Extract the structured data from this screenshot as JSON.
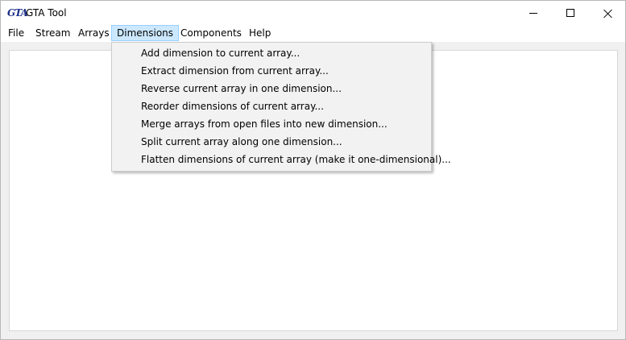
{
  "window": {
    "app_icon_text": "GTA",
    "title": "GTA Tool"
  },
  "menubar": {
    "items": [
      {
        "label": "File"
      },
      {
        "label": "Stream"
      },
      {
        "label": "Arrays"
      },
      {
        "label": "Dimensions",
        "active": true
      },
      {
        "label": "Components"
      },
      {
        "label": "Help"
      }
    ]
  },
  "dimensions_menu": {
    "items": [
      {
        "label": "Add dimension to current array..."
      },
      {
        "label": "Extract dimension from current array..."
      },
      {
        "label": "Reverse current array in one dimension..."
      },
      {
        "label": "Reorder dimensions of current array..."
      },
      {
        "label": "Merge arrays from open files into new dimension..."
      },
      {
        "label": "Split current array along one dimension..."
      },
      {
        "label": "Flatten dimensions of current array (make it one-dimensional)..."
      }
    ]
  },
  "colors": {
    "menu_highlight": "#cce8ff",
    "menu_highlight_border": "#99d1ff",
    "icon_blue": "#1c2f88"
  }
}
